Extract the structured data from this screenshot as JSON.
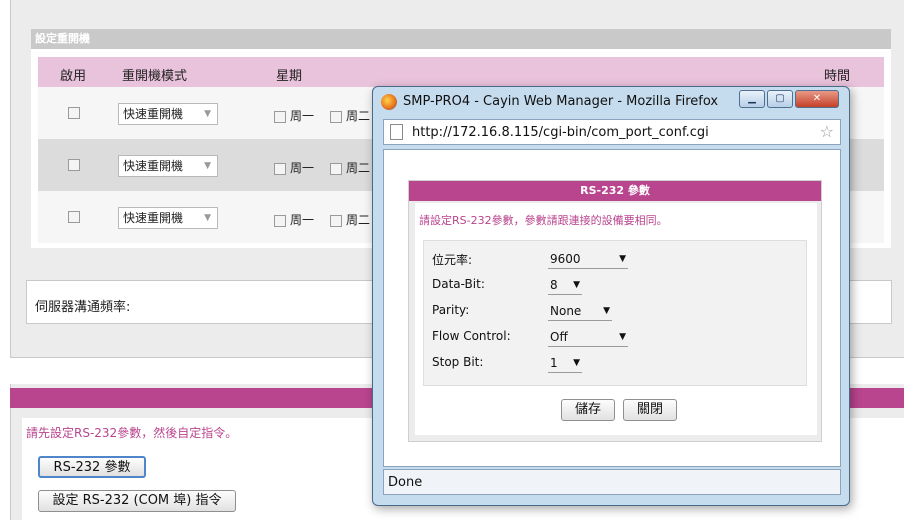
{
  "schedule": {
    "section_title": "設定重開機",
    "columns": {
      "enable": "啟用",
      "mode": "重開機模式",
      "weekday": "星期",
      "time": "時間"
    },
    "rows": [
      {
        "mode": "快速重開機",
        "day1": "周一",
        "day2": "周二"
      },
      {
        "mode": "快速重開機",
        "day1": "周一",
        "day2": "周二"
      },
      {
        "mode": "快速重開機",
        "day1": "周一",
        "day2": "周二"
      }
    ]
  },
  "server": {
    "label": "伺服器溝通頻率:"
  },
  "bottom": {
    "instruction": "請先設定RS-232參數，然後自定指令。",
    "rs232_button": "RS-232 參數",
    "com_button": "設定 RS-232 (COM 埠) 指令"
  },
  "popup": {
    "title": "SMP-PRO4 - Cayin Web Manager - Mozilla Firefox",
    "url": "http://172.16.8.115/cgi-bin/com_port_conf.cgi",
    "status": "Done",
    "dialog": {
      "header": "RS-232 參數",
      "description": "請設定RS-232參數，參數請跟連接的設備要相同。",
      "fields": [
        {
          "label": "位元率:",
          "value": "9600"
        },
        {
          "label": "Data-Bit:",
          "value": "8"
        },
        {
          "label": "Parity:",
          "value": "None"
        },
        {
          "label": "Flow Control:",
          "value": "Off"
        },
        {
          "label": "Stop Bit:",
          "value": "1"
        }
      ],
      "save_label": "儲存",
      "close_label": "關閉"
    }
  },
  "icons": {
    "firefox": "firefox-icon",
    "page": "page-icon",
    "bookmark": "star-icon",
    "dropdown": "chevron-down-icon"
  },
  "colors": {
    "accent": "#b9458e",
    "header_pink": "#e9c2db",
    "window_frame": "#c5dcef"
  }
}
